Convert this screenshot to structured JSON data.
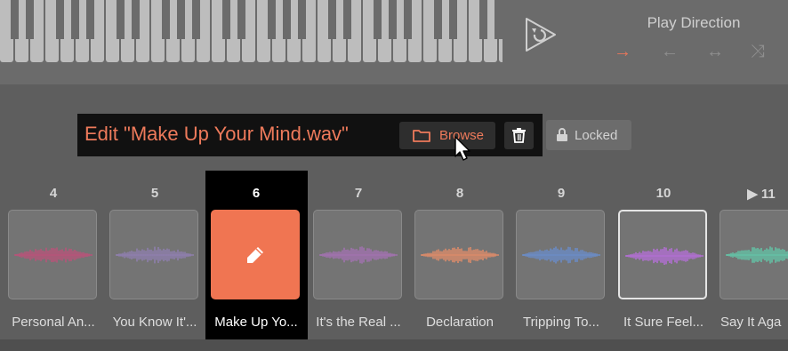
{
  "play_direction": {
    "title": "Play Direction",
    "options": [
      {
        "name": "forward-icon",
        "glyph": "→",
        "active": true
      },
      {
        "name": "reverse-icon",
        "glyph": "←",
        "active": false
      },
      {
        "name": "pingpong-icon",
        "glyph": "↔",
        "active": false
      },
      {
        "name": "shuffle-icon",
        "glyph": "⤨",
        "active": false
      }
    ]
  },
  "edit_bar": {
    "title": "Edit \"Make Up Your Mind.wav\"",
    "browse_label": "Browse",
    "locked_label": "Locked"
  },
  "pads": [
    {
      "number": "4",
      "name": "Personal An...",
      "color": "#b55579"
    },
    {
      "number": "5",
      "name": "You Know It'...",
      "color": "#8e7eac"
    },
    {
      "number": "6",
      "name": "Make Up Yo...",
      "color": "#ffffff",
      "selected": true
    },
    {
      "number": "7",
      "name": "It's the Real ...",
      "color": "#a072ad"
    },
    {
      "number": "8",
      "name": "Declaration",
      "color": "#d98a6a"
    },
    {
      "number": "9",
      "name": "Tripping To...",
      "color": "#6b8bc4"
    },
    {
      "number": "10",
      "name": "It Sure Feel...",
      "color": "#b06fd0",
      "highlighted": true
    },
    {
      "number": "▶ 11",
      "name": "Say It Aga",
      "color": "#64c0a4"
    }
  ],
  "colors": {
    "accent": "#f07552",
    "background": "#5e5e5e",
    "topbar": "#6b6b6b"
  }
}
